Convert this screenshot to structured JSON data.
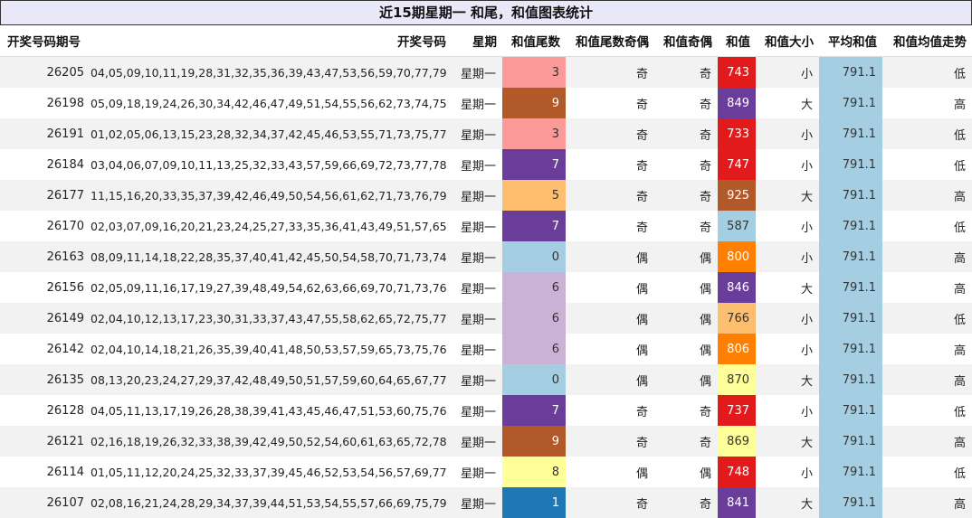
{
  "title": "近15期星期一 和尾，和值图表统计",
  "headers": [
    "开奖号码期号",
    "开奖号码",
    "星期",
    "和值尾数",
    "和值尾数奇偶",
    "和值奇偶",
    "和值",
    "和值大小",
    "平均和值",
    "和值均值走势"
  ],
  "colors": {
    "tail": {
      "0": "#a6cee3",
      "1": "#1f78b4",
      "3": "#fb9a99",
      "5": "#fdbf6f",
      "6": "#cab2d6",
      "7": "#6a3d9a",
      "8": "#ffff99",
      "9": "#b15928"
    },
    "sum": {
      "587": "#a6cee3",
      "733": "#e31a1c",
      "737": "#e31a1c",
      "743": "#e31a1c",
      "747": "#e31a1c",
      "748": "#e31a1c",
      "766": "#fdbf6f",
      "800": "#ff7f00",
      "806": "#ff7f00",
      "841": "#6a3d9a",
      "846": "#6a3d9a",
      "849": "#6a3d9a",
      "869": "#ffff99",
      "870": "#ffff99",
      "925": "#b15928"
    },
    "avg_bg": "#a6cee3",
    "odd_row": "#f2f2f2",
    "title_bg": "#e8e8f8"
  },
  "rows": [
    {
      "issue": "26205",
      "numbers": "04,05,09,10,11,19,28,31,32,35,36,39,43,47,53,56,59,70,77,79",
      "weekday": "星期一",
      "tail": "3",
      "tail_oe": "奇",
      "sum_oe": "奇",
      "sum": "743",
      "size": "小",
      "avg": "791.1",
      "trend": "低"
    },
    {
      "issue": "26198",
      "numbers": "05,09,18,19,24,26,30,34,42,46,47,49,51,54,55,56,62,73,74,75",
      "weekday": "星期一",
      "tail": "9",
      "tail_oe": "奇",
      "sum_oe": "奇",
      "sum": "849",
      "size": "大",
      "avg": "791.1",
      "trend": "高"
    },
    {
      "issue": "26191",
      "numbers": "01,02,05,06,13,15,23,28,32,34,37,42,45,46,53,55,71,73,75,77",
      "weekday": "星期一",
      "tail": "3",
      "tail_oe": "奇",
      "sum_oe": "奇",
      "sum": "733",
      "size": "小",
      "avg": "791.1",
      "trend": "低"
    },
    {
      "issue": "26184",
      "numbers": "03,04,06,07,09,10,11,13,25,32,33,43,57,59,66,69,72,73,77,78",
      "weekday": "星期一",
      "tail": "7",
      "tail_oe": "奇",
      "sum_oe": "奇",
      "sum": "747",
      "size": "小",
      "avg": "791.1",
      "trend": "低"
    },
    {
      "issue": "26177",
      "numbers": "11,15,16,20,33,35,37,39,42,46,49,50,54,56,61,62,71,73,76,79",
      "weekday": "星期一",
      "tail": "5",
      "tail_oe": "奇",
      "sum_oe": "奇",
      "sum": "925",
      "size": "大",
      "avg": "791.1",
      "trend": "高"
    },
    {
      "issue": "26170",
      "numbers": "02,03,07,09,16,20,21,23,24,25,27,33,35,36,41,43,49,51,57,65",
      "weekday": "星期一",
      "tail": "7",
      "tail_oe": "奇",
      "sum_oe": "奇",
      "sum": "587",
      "size": "小",
      "avg": "791.1",
      "trend": "低"
    },
    {
      "issue": "26163",
      "numbers": "08,09,11,14,18,22,28,35,37,40,41,42,45,50,54,58,70,71,73,74",
      "weekday": "星期一",
      "tail": "0",
      "tail_oe": "偶",
      "sum_oe": "偶",
      "sum": "800",
      "size": "小",
      "avg": "791.1",
      "trend": "高"
    },
    {
      "issue": "26156",
      "numbers": "02,05,09,11,16,17,19,27,39,48,49,54,62,63,66,69,70,71,73,76",
      "weekday": "星期一",
      "tail": "6",
      "tail_oe": "偶",
      "sum_oe": "偶",
      "sum": "846",
      "size": "大",
      "avg": "791.1",
      "trend": "高"
    },
    {
      "issue": "26149",
      "numbers": "02,04,10,12,13,17,23,30,31,33,37,43,47,55,58,62,65,72,75,77",
      "weekday": "星期一",
      "tail": "6",
      "tail_oe": "偶",
      "sum_oe": "偶",
      "sum": "766",
      "size": "小",
      "avg": "791.1",
      "trend": "低"
    },
    {
      "issue": "26142",
      "numbers": "02,04,10,14,18,21,26,35,39,40,41,48,50,53,57,59,65,73,75,76",
      "weekday": "星期一",
      "tail": "6",
      "tail_oe": "偶",
      "sum_oe": "偶",
      "sum": "806",
      "size": "小",
      "avg": "791.1",
      "trend": "高"
    },
    {
      "issue": "26135",
      "numbers": "08,13,20,23,24,27,29,37,42,48,49,50,51,57,59,60,64,65,67,77",
      "weekday": "星期一",
      "tail": "0",
      "tail_oe": "偶",
      "sum_oe": "偶",
      "sum": "870",
      "size": "大",
      "avg": "791.1",
      "trend": "高"
    },
    {
      "issue": "26128",
      "numbers": "04,05,11,13,17,19,26,28,38,39,41,43,45,46,47,51,53,60,75,76",
      "weekday": "星期一",
      "tail": "7",
      "tail_oe": "奇",
      "sum_oe": "奇",
      "sum": "737",
      "size": "小",
      "avg": "791.1",
      "trend": "低"
    },
    {
      "issue": "26121",
      "numbers": "02,16,18,19,26,32,33,38,39,42,49,50,52,54,60,61,63,65,72,78",
      "weekday": "星期一",
      "tail": "9",
      "tail_oe": "奇",
      "sum_oe": "奇",
      "sum": "869",
      "size": "大",
      "avg": "791.1",
      "trend": "高"
    },
    {
      "issue": "26114",
      "numbers": "01,05,11,12,20,24,25,32,33,37,39,45,46,52,53,54,56,57,69,77",
      "weekday": "星期一",
      "tail": "8",
      "tail_oe": "偶",
      "sum_oe": "偶",
      "sum": "748",
      "size": "小",
      "avg": "791.1",
      "trend": "低"
    },
    {
      "issue": "26107",
      "numbers": "02,08,16,21,24,28,29,34,37,39,44,51,53,54,55,57,66,69,75,79",
      "weekday": "星期一",
      "tail": "1",
      "tail_oe": "奇",
      "sum_oe": "奇",
      "sum": "841",
      "size": "大",
      "avg": "791.1",
      "trend": "高"
    }
  ]
}
